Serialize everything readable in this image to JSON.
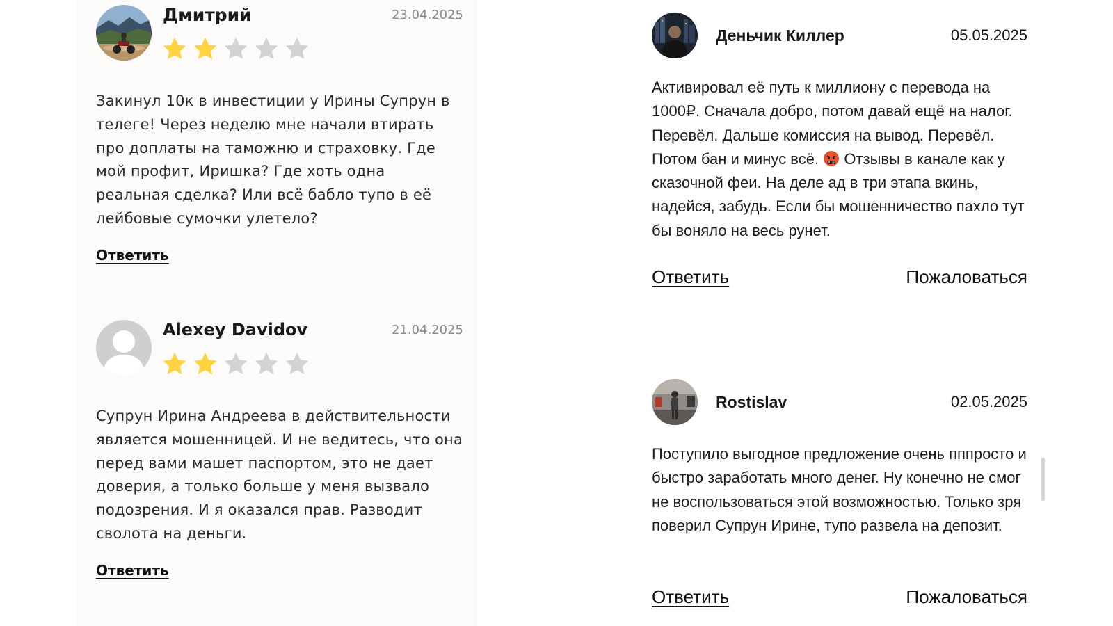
{
  "left_reviews": [
    {
      "author": "Дмитрий",
      "date": "23.04.2025",
      "rating": 2,
      "rating_max": 5,
      "avatar": "photo-motorcycle-rider",
      "text": "Закинул 10к в инвестиции у Ирины Супрун в телеге! Через неделю мне начали втирать про доплаты на таможню и страховку. Где мой профит, Иришка? Где хоть одна реальная сделка? Или всё бабло тупо в её лейбовые сумочки улетело?",
      "reply_label": "Ответить"
    },
    {
      "author": "Alexey Davidov",
      "date": "21.04.2025",
      "rating": 2,
      "rating_max": 5,
      "avatar": "default-user-avatar",
      "text": "Супрун Ирина Андреева в действительности является мошенницей. И не ведитесь, что она перед вами машет паспортом, это не дает доверия, а только больше у меня вызвало подозрения. И я оказался прав. Разводит сволота на деньги.",
      "reply_label": "Ответить"
    }
  ],
  "right_reviews": [
    {
      "author": "Деньчик Киллер",
      "date": "05.05.2025",
      "avatar": "photo-night-city",
      "text_before_emoji": "Активировал её путь к миллиону с перевода на 1000₽. Сначала добро, потом давай ещё на налог. Перевёл. Дальше комиссия на вывод. Перевёл. Потом бан и минус всё. ",
      "emoji": "face-with-symbols-on-mouth",
      "text_after_emoji": " Отзывы в канале как у сказочной феи. На деле ад в три этапа вкинь, надейся, забудь. Если бы мошенничество пахло тут бы воняло на весь рунет.",
      "reply_label": "Ответить",
      "report_label": "Пожаловаться"
    },
    {
      "author": "Rostislav",
      "date": "02.05.2025",
      "avatar": "photo-person-walking",
      "text": "Поступило выгодное предложение очень пппросто и быстро заработать много денег. Ну конечно не смог не воспользоваться этой возможностью. Только зря поверил Супрун Ирине, тупо развела на депозит.",
      "reply_label": "Ответить",
      "report_label": "Пожаловаться"
    }
  ],
  "colors": {
    "star_filled": "#ffd23f",
    "star_empty": "#d3d3d3",
    "left_panel_bg": "#fdfbf9",
    "date_gray": "#8a8a8a",
    "scrollbar": "#d6d6d6"
  }
}
